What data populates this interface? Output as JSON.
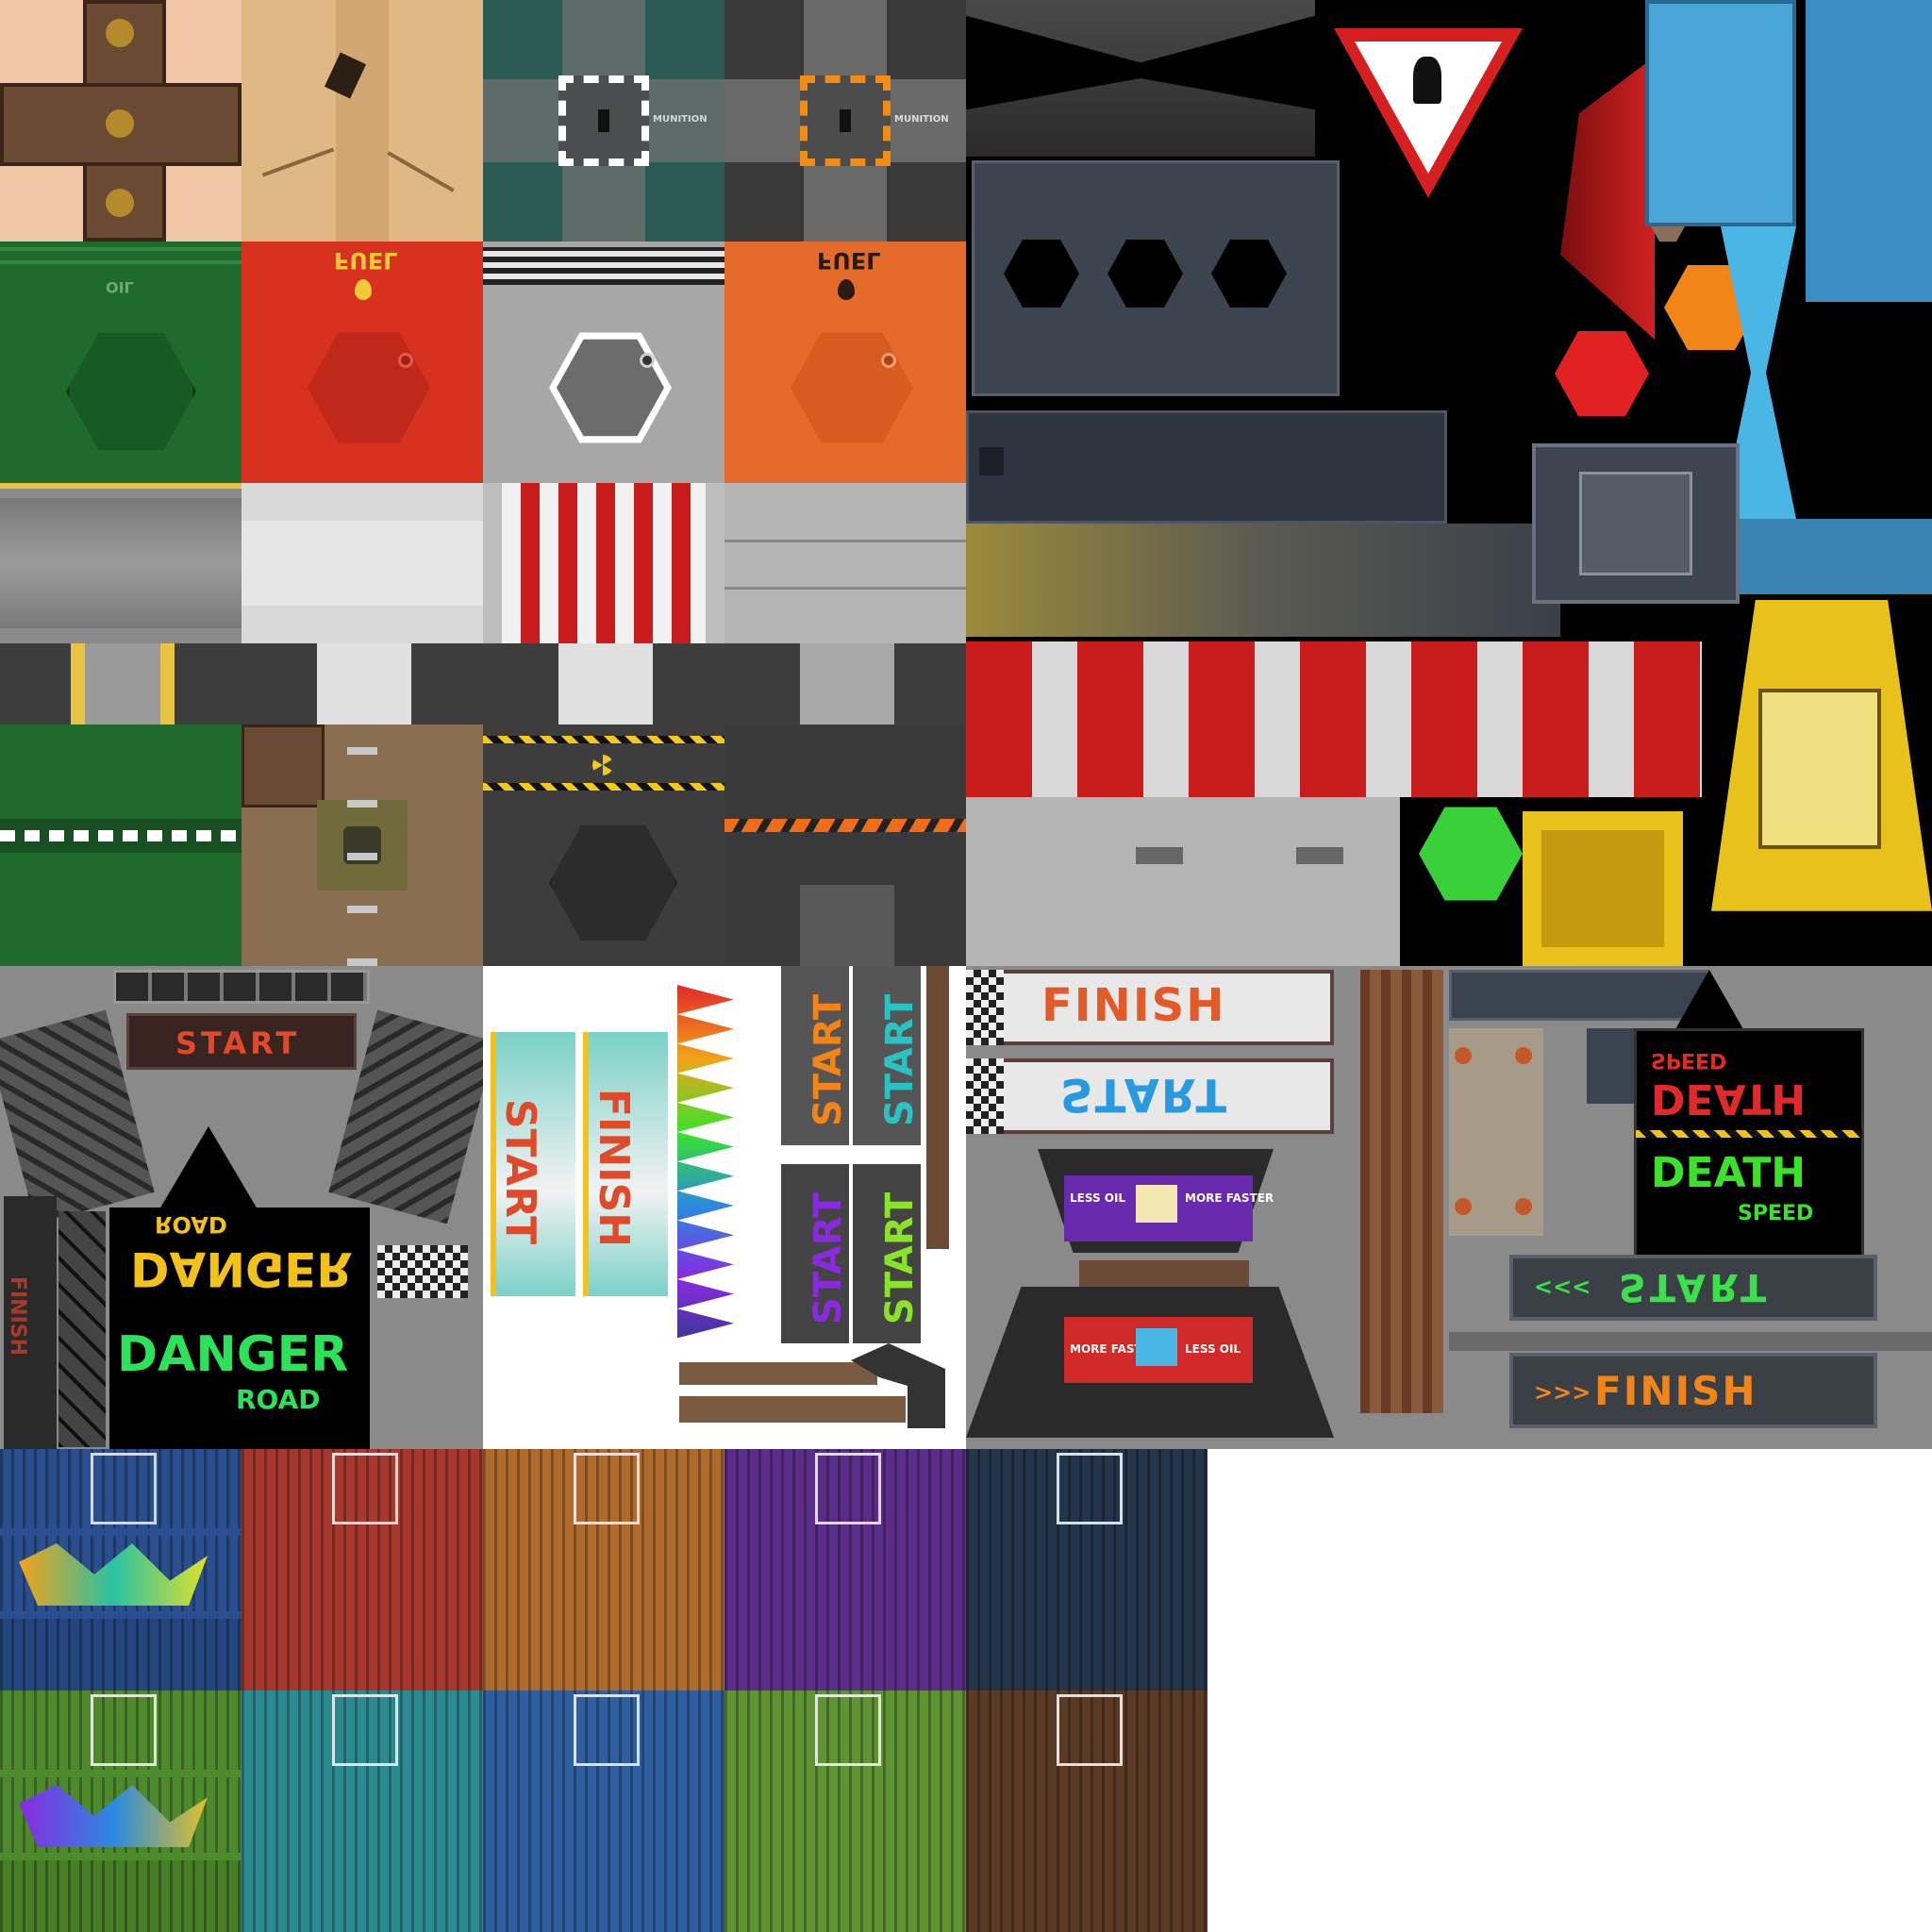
{
  "texture_labels": {
    "oil": "OIL",
    "fuel_red": "FUEL",
    "fuel_orange": "FUEL",
    "munition_left": "MUNITION",
    "munition_right": "MUNITION",
    "start_arch": "START",
    "finish_pillar": "FINISH",
    "danger_top": "DANGER",
    "road_top": "ROAD",
    "danger_bottom": "DANGER",
    "road_bottom": "ROAD",
    "banner_start": "START",
    "banner_finish": "FINISH",
    "start_orange": "START",
    "start_teal": "START",
    "start_purple": "START",
    "start_green": "START",
    "finish_sign": "FINISH",
    "start_sign": "START",
    "more_faster_a": "MORE FASTER",
    "less_oil_a": "LESS OIL",
    "more_faster_b": "MORE FASTER",
    "less_oil_b": "LESS OIL",
    "death_top": "DEATH",
    "speed_top": "SPEED",
    "death_bottom": "DEATH",
    "speed_bottom": "SPEED",
    "start_led": "START",
    "finish_led": "FINISH",
    "arrows_left": "<<<",
    "arrows_right": ">>>"
  },
  "colors": {
    "oil_drum": "#1f6b2e",
    "fuel_red": "#d6321f",
    "fuel_grey": "#a7a7a7",
    "fuel_orange": "#e56b2c",
    "container_blue": "#2a4f8f",
    "container_red": "#a8382c",
    "container_orange": "#b06a2a",
    "container_purple": "#5b2c8a",
    "container_navy": "#24344a",
    "container_green": "#4d8a2c",
    "container_teal": "#2a8a90",
    "container_blue2": "#2d5fa0",
    "container_lime": "#5e9432",
    "container_brown": "#5a3a24"
  },
  "icons": {
    "warning": "falling-person-warning-icon",
    "radiation": "radiation-icon",
    "fuel_drop": "fuel-drop-icon"
  }
}
